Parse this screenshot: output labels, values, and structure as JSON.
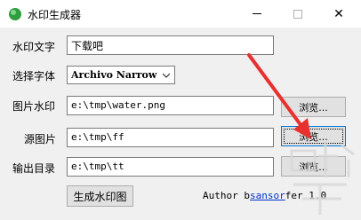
{
  "window": {
    "title": "水印生成器",
    "minimize_glyph": "—",
    "maximize_glyph": "☐",
    "close_glyph": "✕"
  },
  "form": {
    "watermark_text": {
      "label": "水印文字",
      "value": "下载吧"
    },
    "font": {
      "label": "选择字体",
      "value": "Archivo Narrow"
    },
    "image_watermark": {
      "label": "图片水印",
      "value": "e:\\tmp\\water.png",
      "browse": "浏览..."
    },
    "source_image": {
      "label": "源图片",
      "value": "e:\\tmp\\ff",
      "browse": "浏览..."
    },
    "output_dir": {
      "label": "输出目录",
      "value": "e:\\tmp\\tt",
      "browse": "浏览..."
    }
  },
  "actions": {
    "generate": "生成水印图"
  },
  "author": {
    "prefix": "Author b",
    "link": "sansor",
    "suffix": "fer 1.0"
  },
  "colors": {
    "arrow": "#e8312f",
    "link": "#0033cc",
    "window_bg": "#f0f0f0"
  },
  "icons": {
    "app": "green-sphere-icon",
    "select": "chevron-down-icon",
    "watermark": "site-logo-watermark"
  }
}
